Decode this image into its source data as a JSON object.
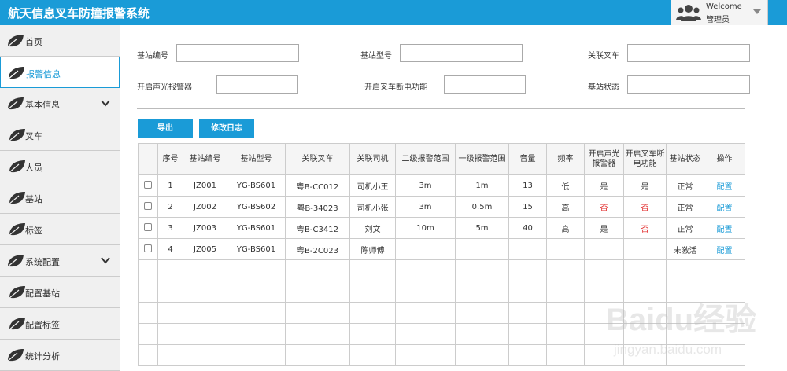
{
  "header": {
    "app_title": "航天信息叉车防撞报警系统",
    "welcome": "Welcome",
    "username": "管理员",
    "brand_color": "#1a9bd7"
  },
  "sidebar": {
    "items": [
      {
        "label": "首页"
      },
      {
        "label": "报警信息"
      },
      {
        "label": "基本信息"
      },
      {
        "label": "叉车"
      },
      {
        "label": "人员"
      },
      {
        "label": "基站"
      },
      {
        "label": "标签"
      },
      {
        "label": "系统配置"
      },
      {
        "label": "配置基站"
      },
      {
        "label": "配置标签"
      },
      {
        "label": "统计分析"
      }
    ]
  },
  "filters": {
    "station_no": {
      "label": "基站编号",
      "value": ""
    },
    "station_model": {
      "label": "基站型号",
      "value": ""
    },
    "linked_forklift": {
      "label": "关联叉车",
      "value": ""
    },
    "sound_light_alarm": {
      "label": "开启声光报警器",
      "value": ""
    },
    "power_cutoff": {
      "label": "开启叉车断电功能",
      "value": ""
    },
    "station_status": {
      "label": "基站状态",
      "value": ""
    }
  },
  "toolbar": {
    "export_label": "导出",
    "modify_log_label": "修改日志"
  },
  "table": {
    "headers": [
      "",
      "序号",
      "基站编号",
      "基站型号",
      "关联叉车",
      "关联司机",
      "二级报警范围",
      "一级报警范围",
      "音量",
      "频率",
      "开启声光报警器",
      "开启叉车断电功能",
      "基站状态",
      "操作"
    ],
    "rows": [
      {
        "no": "1",
        "code": "JZ001",
        "model": "YG-BS601",
        "forklift": "粤B-CC012",
        "driver": "司机小王",
        "range2": "3m",
        "range1": "1m",
        "volume": "13",
        "freq": "低",
        "alarm": "是",
        "cutoff": "是",
        "status": "正常",
        "action": "配置"
      },
      {
        "no": "2",
        "code": "JZ002",
        "model": "YG-BS602",
        "forklift": "粤B-34023",
        "driver": "司机小张",
        "range2": "3m",
        "range1": "0.5m",
        "volume": "15",
        "freq": "高",
        "alarm": "否",
        "cutoff": "否",
        "status": "正常",
        "action": "配置"
      },
      {
        "no": "3",
        "code": "JZ003",
        "model": "YG-BS601",
        "forklift": "粤B-C3412",
        "driver": "刘文",
        "range2": "10m",
        "range1": "5m",
        "volume": "40",
        "freq": "高",
        "alarm": "是",
        "cutoff": "否",
        "status": "正常",
        "action": "配置"
      },
      {
        "no": "4",
        "code": "JZ005",
        "model": "YG-BS601",
        "forklift": "粤B-2C023",
        "driver": "陈师傅",
        "range2": "",
        "range1": "",
        "volume": "",
        "freq": "",
        "alarm": "",
        "cutoff": "",
        "status": "未激活",
        "action": "配置"
      }
    ]
  },
  "watermark": {
    "brand": "Baidu经验",
    "url": "jingyan.baidu.com"
  }
}
